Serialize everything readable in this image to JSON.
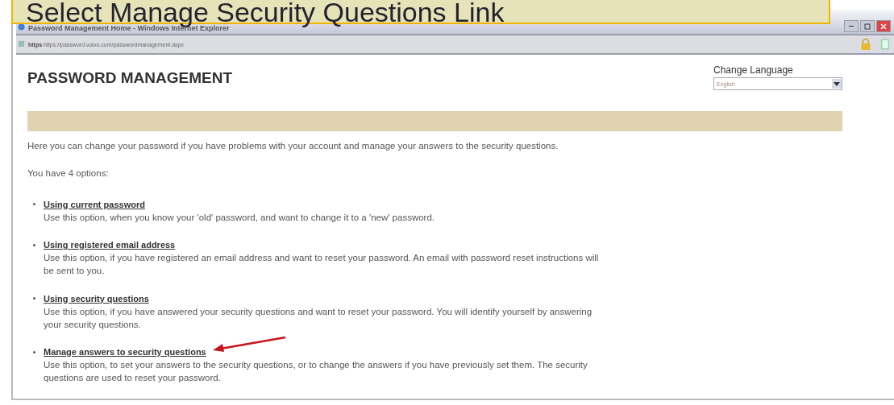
{
  "callout": {
    "text": "Select Manage Security Questions Link"
  },
  "window": {
    "title": "Password Management Home - Windows Internet Explorer"
  },
  "address_bar": {
    "scheme": "https",
    "url": "https://password.volvo.com/passwordmanagement.aspx"
  },
  "page": {
    "heading": "PASSWORD MANAGEMENT",
    "language": {
      "label": "Change Language",
      "value": "English"
    },
    "intro": "Here you can change your password if you have problems with your account and manage your answers to the security questions.",
    "options_intro": "You have 4 options:",
    "options": [
      {
        "link": "Using current password",
        "description": "Use this option, when you know your 'old' password, and want to change it to a 'new' password."
      },
      {
        "link": "Using registered email address",
        "description": "Use this option, if you have registered an email address and want to reset your password. An email with password reset instructions will be sent to you."
      },
      {
        "link": "Using security questions",
        "description": "Use this option, if you have answered your security questions and want to reset your password. You will identify yourself by answering your security questions."
      },
      {
        "link": "Manage answers to security questions",
        "description": "Use this option, to set your answers to the security questions, or to change the answers if you have previously set them. The security questions are used to reset your password.",
        "pointer": {
          "kind": "arrow"
        }
      }
    ]
  }
}
